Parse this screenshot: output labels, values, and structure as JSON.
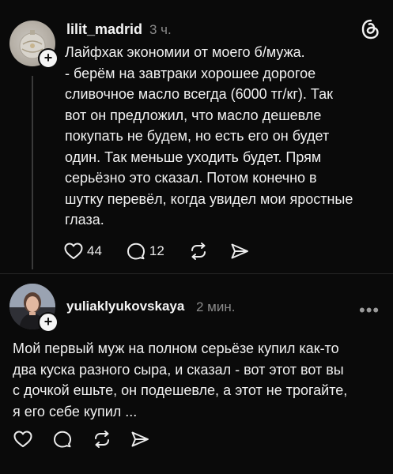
{
  "app": {
    "logo_icon": "threads-logo-icon"
  },
  "post1": {
    "username": "lilit_madrid",
    "time": "3 ч.",
    "text": "Лайфхак экономии от моего б/мужа.\n- берём на завтраки хорошее дорогое\nсливочное масло всегда (6000 тг/кг). Так\nвот он предложил, что масло дешевле\nпокупать не будем, но есть его он будет\nодин. Так меньше уходить будет. Прям\nсерьёзно это сказал.  Потом конечно в\nшутку перевёл, когда увидел мои яростные\nглаза.",
    "likes": "44",
    "comments": "12"
  },
  "post2": {
    "username": "yuliaklyukovskaya",
    "time": "2 мин.",
    "text": "Мой первый муж на полном серьёзе купил как-то\nдва куска разного сыра, и сказал - вот этот вот вы\nс дочкой ешьте, он подешевле, а этот не трогайте,\nя его себе купил ...",
    "more": "•••"
  }
}
